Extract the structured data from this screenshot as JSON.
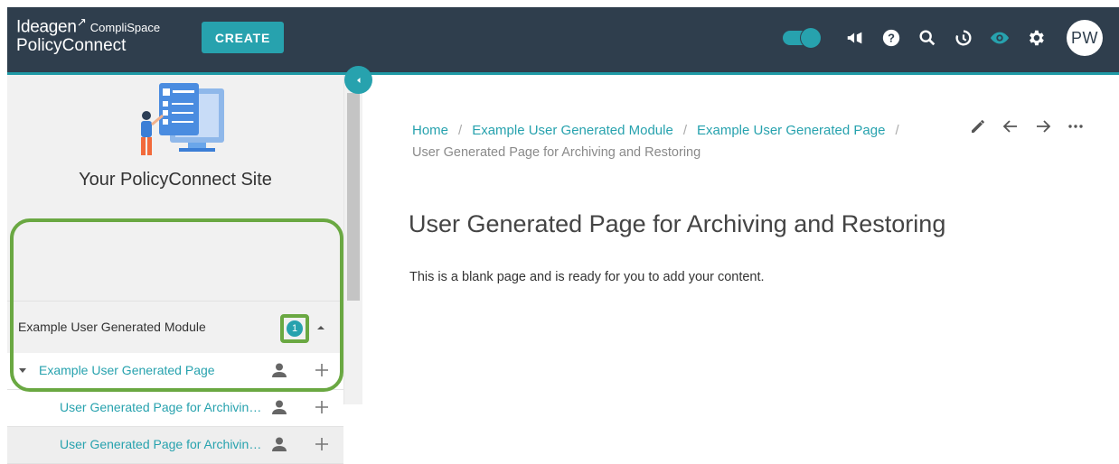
{
  "header": {
    "brand": "Ideagen",
    "brand_sub": "CompliSpace",
    "product": "PolicyConnect",
    "create_label": "CREATE",
    "avatar_initials": "PW",
    "accent": "#27a2ae",
    "bar_color": "#2f3e4d",
    "icons": [
      "toggle",
      "megaphone-icon",
      "help-icon",
      "search-icon",
      "history-icon",
      "eye-icon",
      "gear-icon"
    ]
  },
  "sidebar": {
    "site_title": "Your PolicyConnect Site",
    "module": {
      "label": "Example User Generated Module",
      "badge": "1"
    },
    "items": [
      {
        "label": "Example User Generated Page",
        "level": 0,
        "expanded": true
      },
      {
        "label": "User Generated Page for Archivin…",
        "level": 1
      },
      {
        "label": "User Generated Page for Archivin…",
        "level": 1,
        "highlighted": true
      }
    ],
    "highlight_color": "#6aa842"
  },
  "breadcrumb": {
    "items": [
      "Home",
      "Example User Generated Module",
      "Example User Generated Page"
    ],
    "separator": "/",
    "current": "User Generated Page for Archiving and Restoring"
  },
  "page": {
    "title": "User Generated Page for Archiving and Restoring",
    "body": "This is a blank page and is ready for you to add your content."
  }
}
